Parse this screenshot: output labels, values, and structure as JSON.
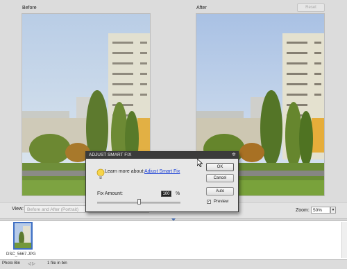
{
  "panes": {
    "before_label": "Before",
    "after_label": "After",
    "reset_label": "Reset"
  },
  "view": {
    "label": "View:",
    "selected": "Before and After (Portrait)"
  },
  "zoom": {
    "label": "Zoom:",
    "value": "50%"
  },
  "photo_bin": {
    "thumbnail_label": "DSC_5667.JPG",
    "title": "Photo Bin",
    "arrows": "◁ ▷",
    "count_text": "1 file in bin"
  },
  "dialog": {
    "title": "ADJUST SMART FIX",
    "learn_text": "Learn more about:",
    "learn_link": "Adjust Smart Fix",
    "fix_amount_label": "Fix Amount:",
    "fix_amount_value": "100",
    "fix_amount_unit": "%",
    "fix_amount_level": 0.5,
    "ok_label": "OK",
    "cancel_label": "Cancel",
    "auto_label": "Auto",
    "preview_label": "Preview",
    "preview_checked": true
  },
  "colors": {
    "dialog_title_bg": "#3b3b3b",
    "link": "#1b3fd6",
    "thumb_border": "#3e6fc4"
  }
}
